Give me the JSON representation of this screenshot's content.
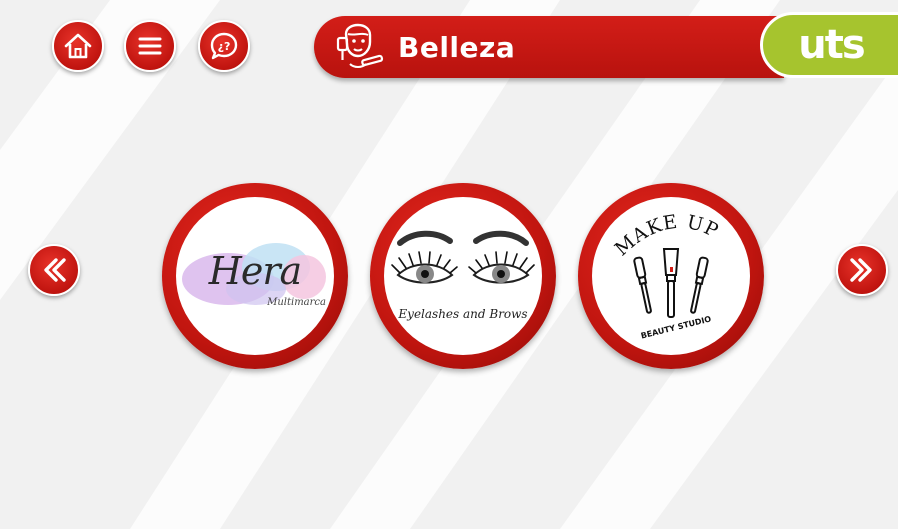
{
  "header": {
    "title": "Belleza",
    "logo_text": "uts",
    "buttons": [
      {
        "name": "home",
        "icon": "home-icon"
      },
      {
        "name": "menu",
        "icon": "hamburger-menu-icon"
      },
      {
        "name": "help",
        "icon": "help-speech-bubble-icon",
        "glyph": "¿?"
      }
    ],
    "title_icon": "beauty-face-icon"
  },
  "carousel": {
    "prev_icon": "chevron-left-icon",
    "next_icon": "chevron-right-icon",
    "stores": [
      {
        "name": "Hera",
        "subtitle": "Multimarca"
      },
      {
        "name": "Eyelashes and Brows"
      },
      {
        "name": "MAKE UP",
        "subtitle": "BEAUTY STUDIO"
      }
    ]
  },
  "colors": {
    "primary_red": "#c0140f",
    "accent_green": "#a6c42e",
    "background": "#f1f1f1"
  }
}
